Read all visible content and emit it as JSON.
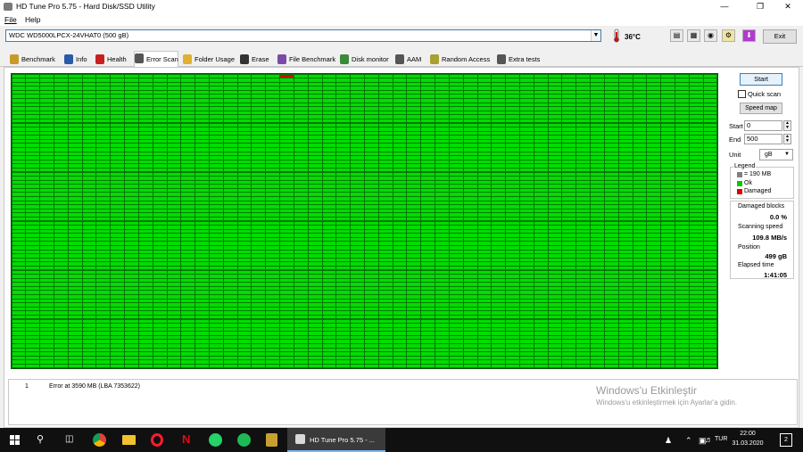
{
  "window": {
    "title": "HD Tune Pro 5.75 - Hard Disk/SSD Utility",
    "minimize_icon": "minimize-icon",
    "maximize_icon": "maximize-icon",
    "close_icon": "close-icon"
  },
  "menu": {
    "items": [
      "File",
      "Help"
    ]
  },
  "toolbar": {
    "drive": "WDC WD5000LPCX-24VHAT0 (500 gB)",
    "temperature": "36°C",
    "exit_label": "Exit",
    "icons": [
      "copy-icon",
      "copy-all-icon",
      "screenshot-icon",
      "options-icon",
      "save-icon"
    ]
  },
  "tabs": [
    {
      "label": "Benchmark",
      "icon": "benchmark-icon",
      "color": "#c89a2a"
    },
    {
      "label": "Info",
      "icon": "info-icon",
      "color": "#2a5aa8"
    },
    {
      "label": "Health",
      "icon": "health-icon",
      "color": "#c82020"
    },
    {
      "label": "Error Scan",
      "icon": "magnifier-icon",
      "color": "#555555"
    },
    {
      "label": "Folder Usage",
      "icon": "folder-icon",
      "color": "#e0b030"
    },
    {
      "label": "Erase",
      "icon": "trash-icon",
      "color": "#333333"
    },
    {
      "label": "File Benchmark",
      "icon": "file-benchmark-icon",
      "color": "#7a4aa8"
    },
    {
      "label": "Disk monitor",
      "icon": "disk-monitor-icon",
      "color": "#3a8a3a"
    },
    {
      "label": "AAM",
      "icon": "aam-icon",
      "color": "#555555"
    },
    {
      "label": "Random Access",
      "icon": "random-access-icon",
      "color": "#a8a030"
    },
    {
      "label": "Extra tests",
      "icon": "extra-tests-icon",
      "color": "#555555"
    }
  ],
  "active_tab": "Error Scan",
  "scan": {
    "grid": {
      "columns": 50,
      "rows": 72,
      "damaged_blocks": [
        [
          19,
          0
        ]
      ],
      "ok_color": "#00dd00",
      "damaged_color": "#e00000",
      "border_color": "#067806"
    },
    "start_label": "Start",
    "quick_scan_label": "Quick scan",
    "quick_scan_checked": false,
    "speed_map_label": "Speed map",
    "start_field_label": "Start",
    "start_value": "0",
    "end_field_label": "End",
    "end_value": "500",
    "unit_label": "Unit",
    "unit_value": "gB"
  },
  "legend": {
    "title": "Legend",
    "items": [
      {
        "label": "= 190 MB",
        "color": "#808080"
      },
      {
        "label": "Ok",
        "color": "#00cc00"
      },
      {
        "label": "Damaged",
        "color": "#e00000"
      }
    ]
  },
  "stats": {
    "damaged_label": "Damaged blocks",
    "damaged_value": "0.0 %",
    "speed_label": "Scanning speed",
    "speed_value": "109.8 MB/s",
    "position_label": "Position",
    "position_value": "499 gB",
    "elapsed_label": "Elapsed time",
    "elapsed_value": "1:41:05"
  },
  "log": [
    {
      "index": "1",
      "message": "Error at 3590 MB (LBA 7353622)"
    }
  ],
  "watermark": {
    "title": "Windows'u Etkinleştir",
    "subtitle": "Windows'u etkinleştirmek için Ayarlar'a gidin."
  },
  "taskbar": {
    "apps": [
      "start-icon",
      "search-icon",
      "task-view-icon",
      "chrome-icon",
      "file-explorer-icon",
      "opera-icon",
      "netflix-icon",
      "whatsapp-icon",
      "spotify-icon",
      "game-icon",
      "steam-icon"
    ],
    "active_app_label": "HD Tune Pro 5.75 - ...",
    "language": "TUR",
    "time": "22:00",
    "date": "31.03.2020",
    "notification_count": "2"
  }
}
